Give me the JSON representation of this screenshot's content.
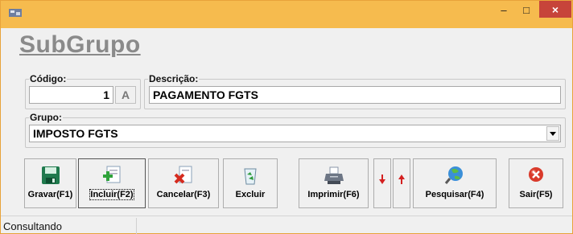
{
  "window": {
    "controls": {
      "minimize": "–",
      "maximize": "□",
      "close": "×"
    }
  },
  "form": {
    "heading": "SubGrupo",
    "codigo": {
      "label": "Código:",
      "value": "1",
      "suffix": "A"
    },
    "descricao": {
      "label": "Descrição:",
      "value": "PAGAMENTO FGTS"
    },
    "grupo": {
      "label": "Grupo:",
      "value": "IMPOSTO FGTS"
    }
  },
  "toolbar": {
    "gravar": "Gravar(F1)",
    "incluir": "Incluir(F2)",
    "cancelar": "Cancelar(F3)",
    "excluir": "Excluir",
    "imprimir": "Imprimir(F6)",
    "pesquisar": "Pesquisar(F4)",
    "sair": "Sair(F5)"
  },
  "status": {
    "text": "Consultando"
  },
  "colors": {
    "titlebar": "#f6bb4e",
    "close": "#c7443a",
    "heading": "#8a8a8a",
    "arrow_red": "#d42020"
  },
  "icons": [
    "app-icon",
    "save-icon",
    "add-icon",
    "cancel-icon",
    "recycle-bin-icon",
    "printer-icon",
    "arrow-down-icon",
    "arrow-up-icon",
    "search-globe-icon",
    "exit-icon",
    "dropdown-arrow-icon"
  ]
}
